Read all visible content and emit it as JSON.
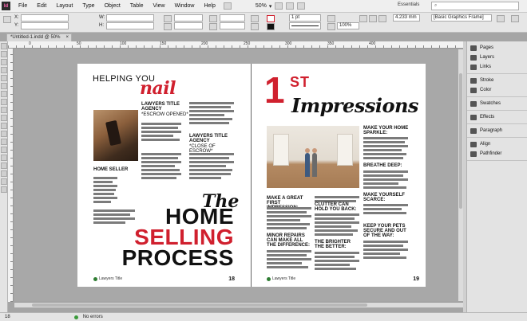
{
  "menubar": {
    "app_badge": "Id",
    "items": [
      "File",
      "Edit",
      "Layout",
      "Type",
      "Object",
      "Table",
      "View",
      "Window",
      "Help"
    ],
    "zoom": "50%",
    "workspace": "Essentials",
    "search_placeholder": ""
  },
  "control": {
    "x_label": "X:",
    "y_label": "Y:",
    "w_label": "W:",
    "h_label": "H:",
    "stroke_weight": "1 pt",
    "width_value": "4.233 mm",
    "opacity": "100%",
    "frame_style": "[Basic Graphics Frame]"
  },
  "document": {
    "tab_title": "*Untitled-1.indd @ 50%",
    "tab_close": "×"
  },
  "ruler": {
    "ticks": [
      "0",
      "50",
      "100",
      "150",
      "200",
      "250",
      "300",
      "350",
      "400"
    ]
  },
  "left_page": {
    "helping": "HELPING YOU",
    "nail": "nail",
    "lawyers1_title": "LAWYERS TITLE AGENCY",
    "lawyers1_sub": "*ESCROW OPENED*",
    "lawyers2_title": "LAWYERS TITLE AGENCY",
    "lawyers2_sub": "*CLOSE OF ESCROW*",
    "home_seller": "HOME SELLER",
    "the": "The",
    "home": "HOME",
    "selling": "SELLING",
    "process": "PROCESS",
    "logo_text": "Lawyers Title",
    "page_number": "18"
  },
  "right_page": {
    "one": "1",
    "st": "ST",
    "impressions": "Impressions",
    "h_sparkle": "MAKE YOUR HOME SPARKLE:",
    "h_breathe": "BREATHE DEEP:",
    "h_scarce": "MAKE YOURSELF SCARCE:",
    "h_pets": "KEEP YOUR PETS SECURE AND OUT OF THE WAY:",
    "h_first": "MAKE A GREAT FIRST IMPRESSION:",
    "h_clutter": "CLUTTER CAN HOLD YOU BACK:",
    "h_minor": "MINOR REPAIRS CAN MAKE ALL THE DIFFERENCE:",
    "h_brighter": "THE BRIGHTER THE BETTER:",
    "logo_text": "Lawyers Title",
    "page_number": "19"
  },
  "panels": {
    "groups": [
      [
        "Pages",
        "Layers",
        "Links"
      ],
      [
        "Stroke",
        "Color"
      ],
      [
        "Swatches"
      ],
      [
        "Effects"
      ],
      [
        "Paragraph"
      ],
      [
        "Align",
        "Pathfinder"
      ]
    ]
  },
  "status": {
    "page": "18",
    "errors": "No errors"
  }
}
